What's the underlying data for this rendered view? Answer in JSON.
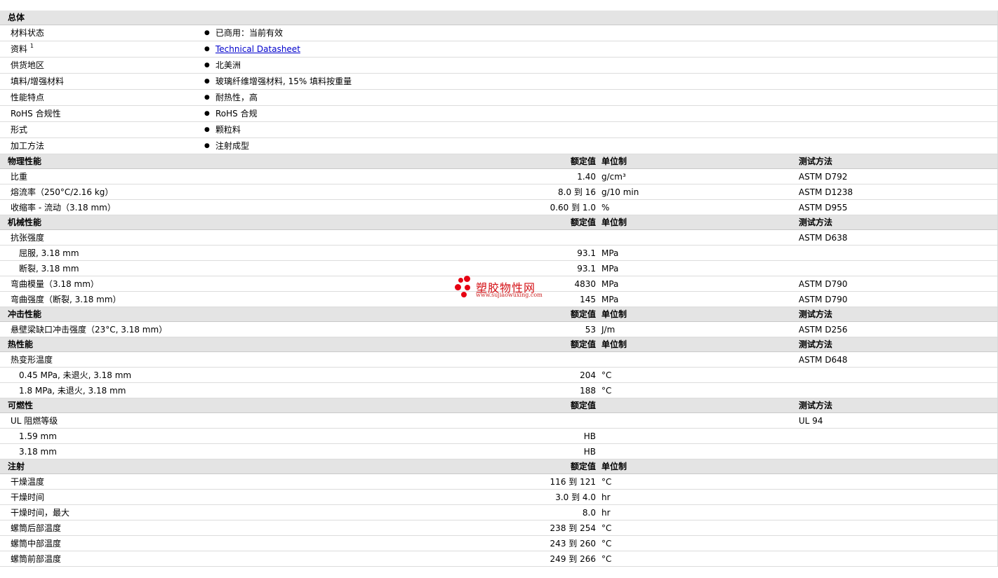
{
  "general": {
    "title": "总体",
    "rows": [
      {
        "label": "材料状态",
        "value": "已商用：当前有效"
      },
      {
        "label": "资料",
        "sup": "1",
        "link": "Technical Datasheet"
      },
      {
        "label": "供货地区",
        "value": "北美洲"
      },
      {
        "label": "填料/增强材料",
        "value": "玻璃纤维增强材料, 15% 填料按重量"
      },
      {
        "label": "性能特点",
        "value": "耐热性，高"
      },
      {
        "label": "RoHS 合规性",
        "value": "RoHS 合规"
      },
      {
        "label": "形式",
        "value": "颗粒料"
      },
      {
        "label": "加工方法",
        "value": "注射成型"
      }
    ]
  },
  "sections": [
    {
      "title": "物理性能",
      "nominal": "额定值",
      "unit": "单位制",
      "test": "测试方法",
      "rows": [
        {
          "label": "比重",
          "value": "1.40",
          "unit": "g/cm³",
          "test": "ASTM D792"
        },
        {
          "label": "熔流率（250°C/2.16 kg）",
          "value": "8.0 到 16",
          "unit": "g/10 min",
          "test": "ASTM D1238"
        },
        {
          "label": "收缩率 - 流动（3.18 mm）",
          "value": "0.60 到 1.0",
          "unit": "%",
          "test": "ASTM D955"
        }
      ]
    },
    {
      "title": "机械性能",
      "nominal": "额定值",
      "unit": "单位制",
      "test": "测试方法",
      "rows": [
        {
          "label": "抗张强度",
          "value": "",
          "unit": "",
          "test": "ASTM D638"
        },
        {
          "label": "屈服, 3.18 mm",
          "sub": true,
          "value": "93.1",
          "unit": "MPa",
          "test": ""
        },
        {
          "label": "断裂, 3.18 mm",
          "sub": true,
          "value": "93.1",
          "unit": "MPa",
          "test": ""
        },
        {
          "label": "弯曲模量（3.18 mm）",
          "value": "4830",
          "unit": "MPa",
          "test": "ASTM D790"
        },
        {
          "label": "弯曲强度（断裂, 3.18 mm）",
          "value": "145",
          "unit": "MPa",
          "test": "ASTM D790"
        }
      ]
    },
    {
      "title": "冲击性能",
      "nominal": "额定值",
      "unit": "单位制",
      "test": "测试方法",
      "rows": [
        {
          "label": "悬壁梁缺口冲击强度（23°C, 3.18 mm）",
          "value": "53",
          "unit": "J/m",
          "test": "ASTM D256"
        }
      ]
    },
    {
      "title": "热性能",
      "nominal": "额定值",
      "unit": "单位制",
      "test": "测试方法",
      "rows": [
        {
          "label": "热变形温度",
          "value": "",
          "unit": "",
          "test": "ASTM D648"
        },
        {
          "label": "0.45 MPa, 未退火, 3.18 mm",
          "sub": true,
          "value": "204",
          "unit": "°C",
          "test": ""
        },
        {
          "label": "1.8 MPa, 未退火, 3.18 mm",
          "sub": true,
          "value": "188",
          "unit": "°C",
          "test": ""
        }
      ]
    },
    {
      "title": "可燃性",
      "nominal": "额定值",
      "unit": "",
      "test": "测试方法",
      "rows": [
        {
          "label": "UL 阻燃等级",
          "value": "",
          "unit": "",
          "test": "UL 94"
        },
        {
          "label": "1.59 mm",
          "sub": true,
          "value": "HB",
          "unit": "",
          "test": ""
        },
        {
          "label": "3.18 mm",
          "sub": true,
          "value": "HB",
          "unit": "",
          "test": ""
        }
      ]
    },
    {
      "title": "注射",
      "nominal": "额定值",
      "unit": "单位制",
      "test": "",
      "rows": [
        {
          "label": "干燥温度",
          "value": "116 到 121",
          "unit": "°C",
          "test": ""
        },
        {
          "label": "干燥时间",
          "value": "3.0 到 4.0",
          "unit": "hr",
          "test": ""
        },
        {
          "label": "干燥时间，最大",
          "value": "8.0",
          "unit": "hr",
          "test": ""
        },
        {
          "label": "螺筒后部温度",
          "value": "238 到 254",
          "unit": "°C",
          "test": ""
        },
        {
          "label": "螺筒中部温度",
          "value": "243 到 260",
          "unit": "°C",
          "test": ""
        },
        {
          "label": "螺筒前部温度",
          "value": "249 到 266",
          "unit": "°C",
          "test": ""
        }
      ]
    }
  ],
  "watermark": {
    "name": "塑胶物性网",
    "url": "www.sujiaowuxing.com"
  }
}
